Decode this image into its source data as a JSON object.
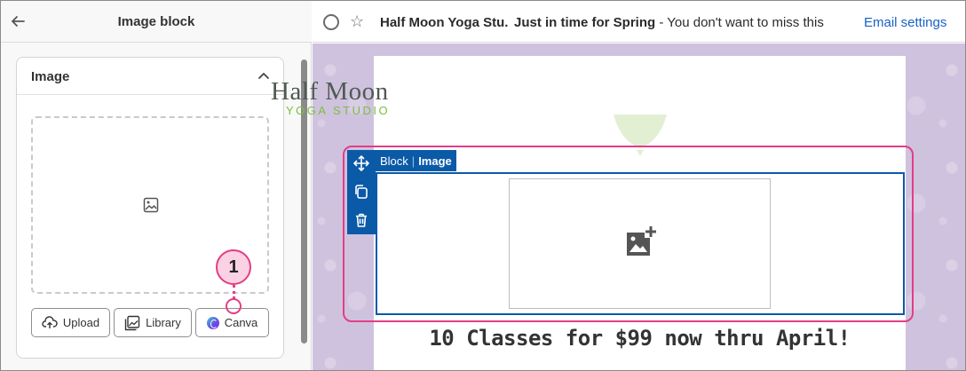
{
  "left_panel": {
    "title": "Image block",
    "section": {
      "title": "Image"
    },
    "buttons": {
      "upload": "Upload",
      "library": "Library",
      "canva": "Canva"
    }
  },
  "callout": {
    "number": "1"
  },
  "email_header": {
    "sender": "Half Moon Yoga Stu.",
    "subject_bold": "Just in time for Spring",
    "subject_rest": " - You don't want to miss this",
    "settings_link": "Email settings"
  },
  "email_preview": {
    "logo_main": "Half Moon",
    "logo_sub": "YOGA STUDIO",
    "block_tab": {
      "part1": "Block",
      "separator": "|",
      "part2": "Image"
    },
    "headline": "10 Classes for $99 now thru April!"
  },
  "colors": {
    "selection_pink": "#e23e86",
    "block_blue": "#0b5aa8",
    "link_blue": "#1762c5",
    "background_lavender": "#cfc2de"
  },
  "icons": [
    "back-arrow-icon",
    "chevron-up-icon",
    "image-icon",
    "upload-icon",
    "library-icon",
    "canva-icon",
    "circle-checkbox-icon",
    "star-icon",
    "move-icon",
    "duplicate-icon",
    "trash-icon",
    "image-add-icon"
  ]
}
